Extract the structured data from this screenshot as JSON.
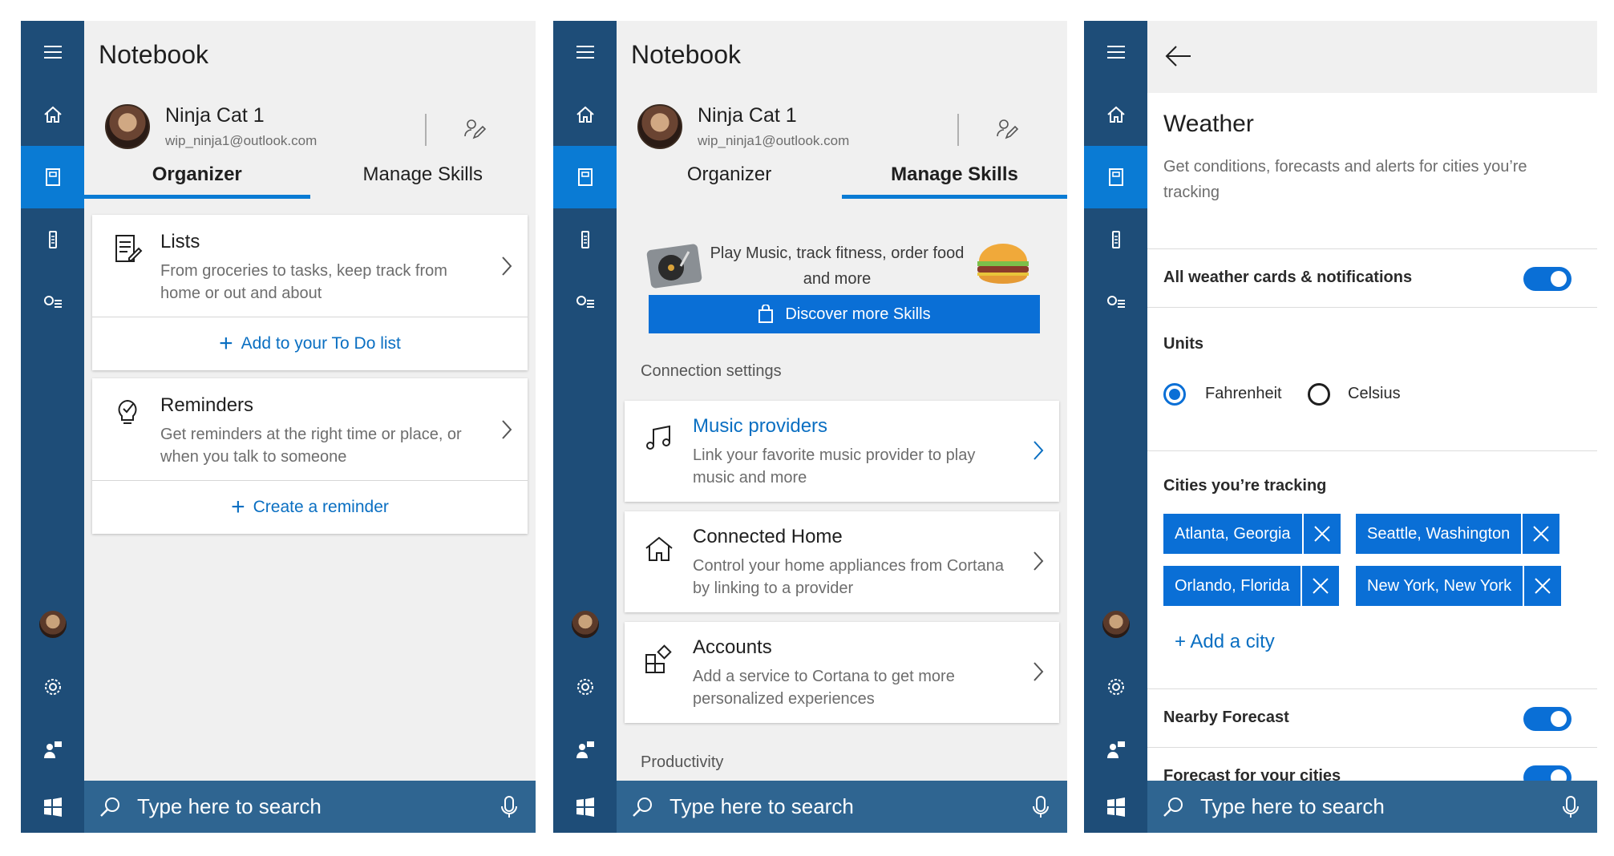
{
  "rail": {
    "icons": [
      "hamburger-icon",
      "home-icon",
      "notebook-icon",
      "device-icon",
      "interests-icon",
      "avatar",
      "gear-icon",
      "feedback-icon"
    ]
  },
  "taskbar": {
    "search_placeholder": "Type here to search"
  },
  "profile": {
    "name": "Ninja Cat 1",
    "email": "wip_ninja1@outlook.com"
  },
  "panel1": {
    "title": "Notebook",
    "tabs": [
      {
        "label": "Organizer",
        "active": true
      },
      {
        "label": "Manage Skills",
        "active": false
      }
    ],
    "cards": [
      {
        "title": "Lists",
        "description": "From groceries to tasks, keep track from home or out and about",
        "action": "Add to your To Do list",
        "icon": "list-icon"
      },
      {
        "title": "Reminders",
        "description": "Get reminders at the right time or place, or when you talk to someone",
        "action": "Create a reminder",
        "icon": "reminder-icon"
      }
    ]
  },
  "panel2": {
    "title": "Notebook",
    "tabs": [
      {
        "label": "Organizer",
        "active": false
      },
      {
        "label": "Manage Skills",
        "active": true
      }
    ],
    "promo": {
      "text": "Play Music, track fitness, order food and more",
      "button": "Discover more Skills"
    },
    "section_connection": "Connection settings",
    "cards": [
      {
        "title": "Music providers",
        "description": "Link your favorite music provider to play music and more",
        "icon": "music-note-icon"
      },
      {
        "title": "Connected Home",
        "description": "Control your home appliances from Cortana by linking to a provider",
        "icon": "home-outline-icon"
      },
      {
        "title": "Accounts",
        "description": "Add a service to Cortana to get more personalized experiences",
        "icon": "accounts-icon"
      }
    ],
    "section_productivity": "Productivity"
  },
  "panel3": {
    "title": "Weather",
    "description": "Get conditions, forecasts and alerts for cities you’re tracking",
    "all_cards_label": "All weather cards & notifications",
    "units_label": "Units",
    "unit_options": [
      {
        "label": "Fahrenheit",
        "selected": true
      },
      {
        "label": "Celsius",
        "selected": false
      }
    ],
    "cities_label": "Cities you’re tracking",
    "cities": [
      "Atlanta, Georgia",
      "Seattle, Washington",
      "Orlando, Florida",
      "New York, New York"
    ],
    "add_city": "+ Add a city",
    "nearby_label": "Nearby Forecast",
    "cities_forecast_label": "Forecast for your cities"
  },
  "colors": {
    "rail": "#1e4d78",
    "rail_active": "#0a7bd4",
    "taskbar": "#2f6591",
    "accent": "#0a6fd6",
    "link": "#0a6fc2"
  }
}
